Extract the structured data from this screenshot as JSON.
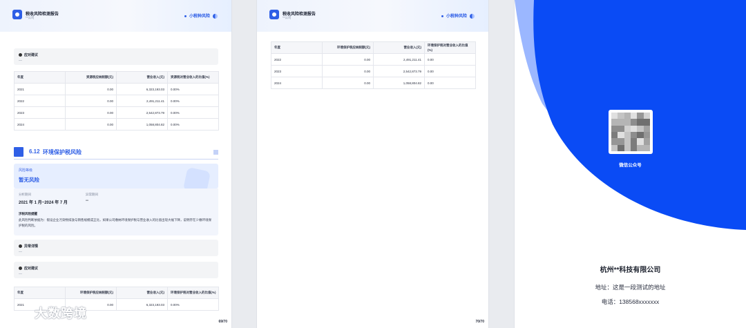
{
  "header": {
    "doc_title": "税收风险检测报告",
    "doc_sub": "**公司",
    "tag": "小税种风险"
  },
  "page1": {
    "box_advice_1": {
      "title": "应对建议",
      "text": "—"
    },
    "table1": {
      "headers": [
        "年度",
        "资源税应纳税额(元)",
        "营业收入(元)",
        "资源税对营业收入的比值(%)"
      ],
      "rows": [
        [
          "2021",
          "0.00",
          "6,323,193.03",
          "0.00%"
        ],
        [
          "2022",
          "0.00",
          "2,491,211.41",
          "0.00%"
        ],
        [
          "2023",
          "0.00",
          "2,542,873.79",
          "0.00%"
        ],
        [
          "2024",
          "0.00",
          "1,058,804.82",
          "0.00%"
        ]
      ]
    },
    "section": {
      "number": "6.12",
      "title": "环境保护税风险"
    },
    "risk": {
      "level_label": "风险等级",
      "level_value": "暂无风险",
      "period_label": "分析期间",
      "period_value": "2021 年 1 月~2024 年 7 月",
      "ref_label": "异常期间",
      "ref_value": "--",
      "desc_title": "涉税风险提醒",
      "desc_text": "此风险判断依据为：假设企业污染物排放与销售规模成正比，如果公司缴纳环境保护税与营业收入的比值出现大幅下降，说明存在少缴环境保护税的风险。"
    },
    "box_abnormal": {
      "title": "异常详情",
      "text": "—"
    },
    "box_advice_2": {
      "title": "应对建议",
      "text": "—"
    },
    "table2": {
      "headers": [
        "年度",
        "环境保护税应纳税额(元)",
        "营业收入(元)",
        "环境保护税对营业收入的比值(%)"
      ],
      "rows": [
        [
          "2021",
          "0.00",
          "6,323,193.03",
          "0.00%"
        ]
      ]
    },
    "page_no": "69/70"
  },
  "page2": {
    "table": {
      "headers": [
        "年度",
        "环境保护税应纳税额(元)",
        "营业收入(元)",
        "环境保护税对营业收入的比值(%)"
      ],
      "rows": [
        [
          "2022",
          "0.00",
          "2,491,211.41",
          "0.00"
        ],
        [
          "2023",
          "0.00",
          "2,542,873.79",
          "0.00"
        ],
        [
          "2024",
          "0.00",
          "1,058,804.82",
          "0.00"
        ]
      ]
    },
    "page_no": "70/70"
  },
  "cover": {
    "qr_caption": "微信公众号",
    "company": "杭州**科技有限公司",
    "address": "地址：这是一段测试的地址",
    "phone": "电话：138568xxxxxxx"
  },
  "watermark": "大数跨境",
  "colors": {
    "brand_blue": "#0a4bf5",
    "accent": "#2f5fe6",
    "light_blue": "#9bb7ff"
  }
}
